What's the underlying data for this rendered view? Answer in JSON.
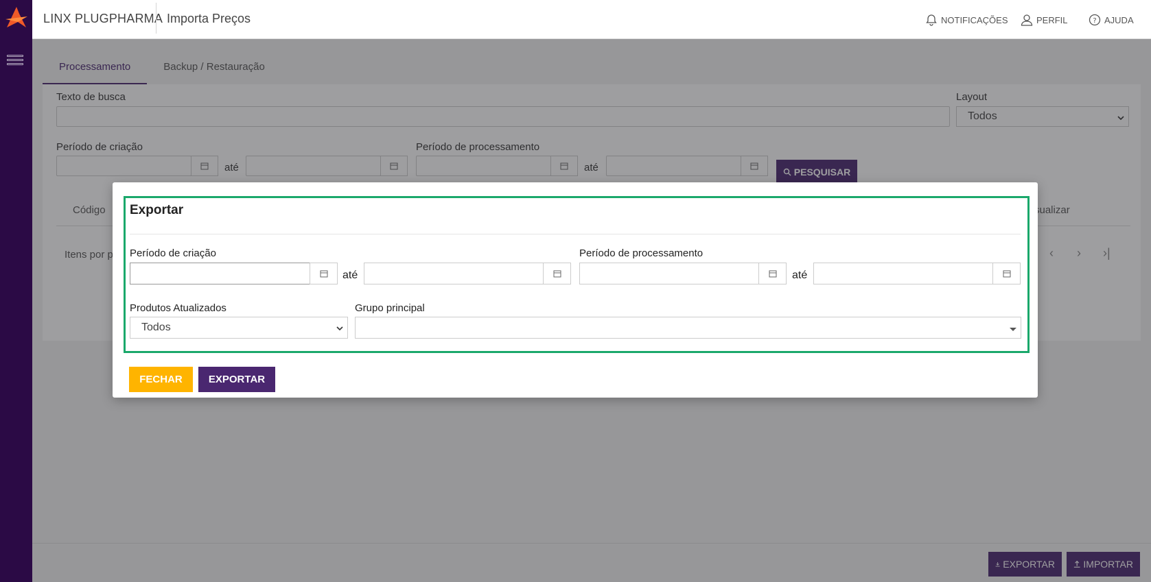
{
  "header": {
    "app_name": "LINX PLUGPHARMA",
    "page_title": "Importa Preços",
    "notifications_label": "NOTIFICAÇÕES",
    "profile_label": "PERFIL",
    "help_label": "AJUDA"
  },
  "tabs": [
    {
      "label": "Processamento",
      "active": true
    },
    {
      "label": "Backup / Restauração",
      "active": false
    }
  ],
  "filters": {
    "search_label": "Texto de busca",
    "search_value": "",
    "layout_label": "Layout",
    "layout_value": "Todos",
    "creation_period_label": "Período de criação",
    "processing_period_label": "Período de processamento",
    "until_label": "até",
    "search_button": "PESQUISAR"
  },
  "table": {
    "col_code": "Código",
    "col_view_partial": "sualizar",
    "items_per_page_partial": "Itens por p"
  },
  "footer": {
    "export_button": "EXPORTAR",
    "import_button": "IMPORTAR"
  },
  "modal": {
    "title": "Exportar",
    "creation_period_label": "Período de criação",
    "processing_period_label": "Período de processamento",
    "until_label": "até",
    "updated_products_label": "Produtos Atualizados",
    "updated_products_value": "Todos",
    "main_group_label": "Grupo principal",
    "main_group_value": "",
    "close_button": "FECHAR",
    "export_button": "EXPORTAR"
  },
  "colors": {
    "sidebar": "#2b0a45",
    "primary": "#4a2770",
    "warning": "#ffb400",
    "highlight": "#1aa86b"
  }
}
